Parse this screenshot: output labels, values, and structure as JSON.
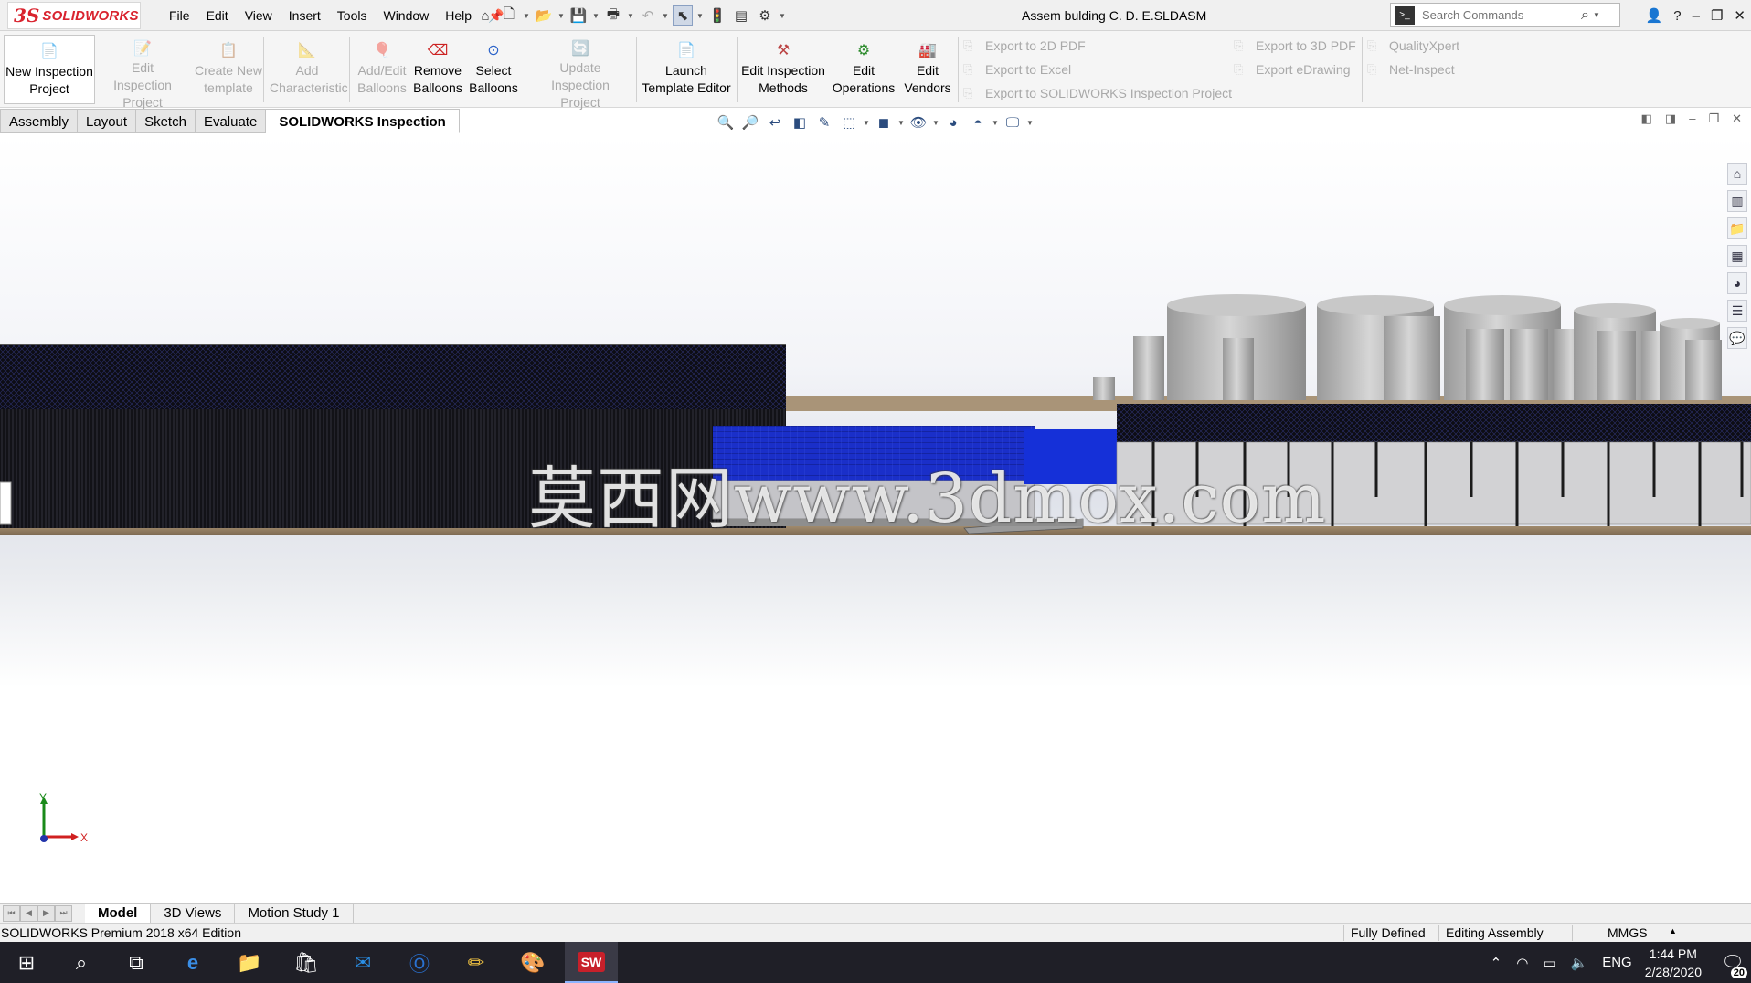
{
  "app": {
    "logo_ds": "3S",
    "logo_text": "SOLIDWORKS"
  },
  "menu": [
    "File",
    "Edit",
    "View",
    "Insert",
    "Tools",
    "Window",
    "Help"
  ],
  "document": {
    "title": "Assem bulding  C. D. E.SLDASM"
  },
  "search": {
    "placeholder": "Search Commands"
  },
  "ribbon": {
    "new_inspection_project": "New Inspection Project",
    "edit_inspection_project": "Edit Inspection Project",
    "create_new_template": "Create New template",
    "add_characteristic": "Add Characteristic",
    "add_edit_balloons": "Add/Edit Balloons",
    "remove_balloons": "Remove Balloons",
    "select_balloons": "Select Balloons",
    "update_inspection_project": "Update Inspection Project",
    "launch_template_editor": "Launch Template Editor",
    "edit_inspection_methods": "Edit Inspection Methods",
    "edit_operations": "Edit Operations",
    "edit_vendors": "Edit Vendors",
    "export_2d_pdf": "Export to 2D PDF",
    "export_excel": "Export to Excel",
    "export_sw_inspection": "Export to SOLIDWORKS Inspection Project",
    "export_3d_pdf": "Export to 3D PDF",
    "export_edrawing": "Export eDrawing",
    "qualityxpert": "QualityXpert",
    "net_inspect": "Net-Inspect"
  },
  "tabs": [
    "Assembly",
    "Layout",
    "Sketch",
    "Evaluate",
    "SOLIDWORKS Inspection"
  ],
  "viewport": {
    "watermark": "莫西网www.3dmox.com",
    "triad_x": "X",
    "triad_y": "Y"
  },
  "bottom_tabs": [
    "Model",
    "3D Views",
    "Motion Study 1"
  ],
  "status": {
    "edition": "SOLIDWORKS Premium 2018 x64 Edition",
    "defined": "Fully Defined",
    "editing": "Editing Assembly",
    "units": "MMGS"
  },
  "taskbar": {
    "lang": "ENG",
    "time": "1:44 PM",
    "date": "2/28/2020",
    "notifications": "20",
    "sw_label": "SW"
  },
  "colors": {
    "accent_red": "#d9232e",
    "blue_structure": "#1a2fc9",
    "taskbar": "#1f1f27"
  }
}
